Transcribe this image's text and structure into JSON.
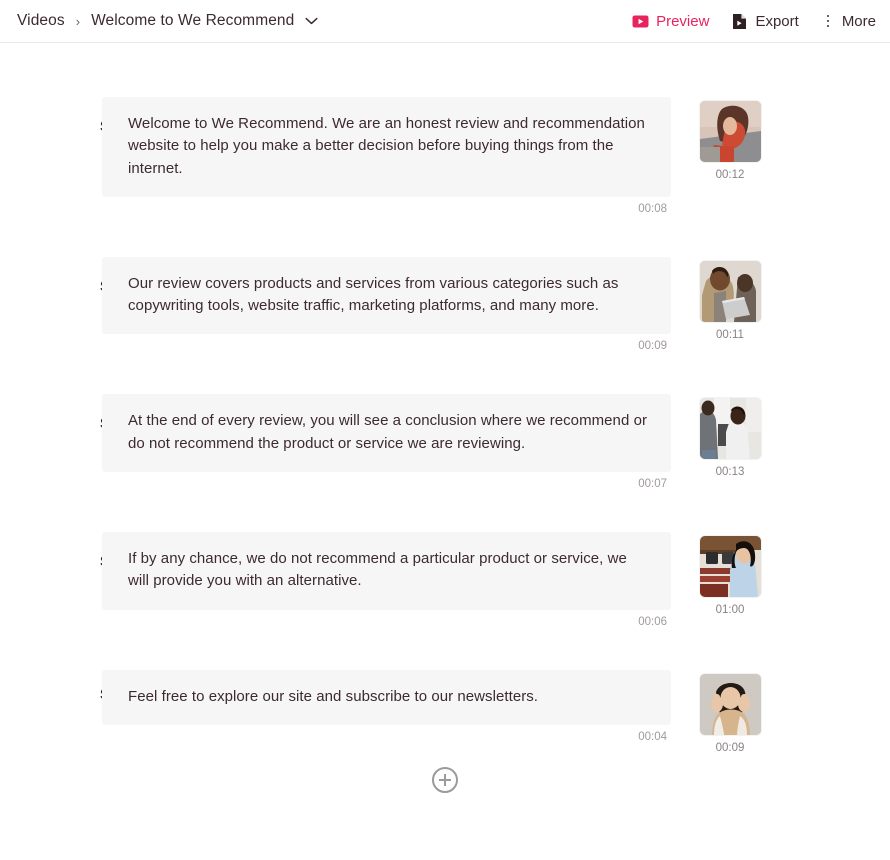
{
  "header": {
    "breadcrumb_root": "Videos",
    "breadcrumb_separator": "›",
    "breadcrumb_title": "Welcome to We Recommend",
    "actions": {
      "preview_label": "Preview",
      "export_label": "Export",
      "more_label": "More"
    },
    "colors": {
      "preview_accent": "#e8245f",
      "text": "#3c2a2e",
      "border": "#e9e9ea"
    }
  },
  "script": {
    "rows": [
      {
        "speaker": "Sara",
        "text": "Welcome to We Recommend. We are an honest review and recommendation website to help you make a better decision before buying things from the internet.",
        "audio_duration": "00:08",
        "clip_duration": "00:12",
        "thumbnail": "woman-in-red-top-at-laptop"
      },
      {
        "speaker": "Sara",
        "text": "Our review covers products and services from various categories such as copywriting tools, website traffic, marketing platforms, and many more.",
        "audio_duration": "00:09",
        "clip_duration": "00:11",
        "thumbnail": "man-in-beige-blazer-holding-laptop"
      },
      {
        "speaker": "Sara",
        "text": "At the end of every review, you will see a conclusion where we recommend or do not recommend the product or service we are reviewing.",
        "audio_duration": "00:07",
        "clip_duration": "00:13",
        "thumbnail": "two-people-standing-in-office"
      },
      {
        "speaker": "Sara",
        "text": "If by any chance, we do not recommend a particular product or service, we will provide you with an alternative.",
        "audio_duration": "00:06",
        "clip_duration": "01:00",
        "thumbnail": "woman-in-blue-shirt-in-bag-shop"
      },
      {
        "speaker": "Sara",
        "text": "Feel free to explore our site and subscribe to our newsletters.",
        "audio_duration": "00:04",
        "clip_duration": "00:09",
        "thumbnail": "person-giving-two-thumbs-up"
      }
    ]
  },
  "footer": {
    "add_scene_label": "+"
  }
}
